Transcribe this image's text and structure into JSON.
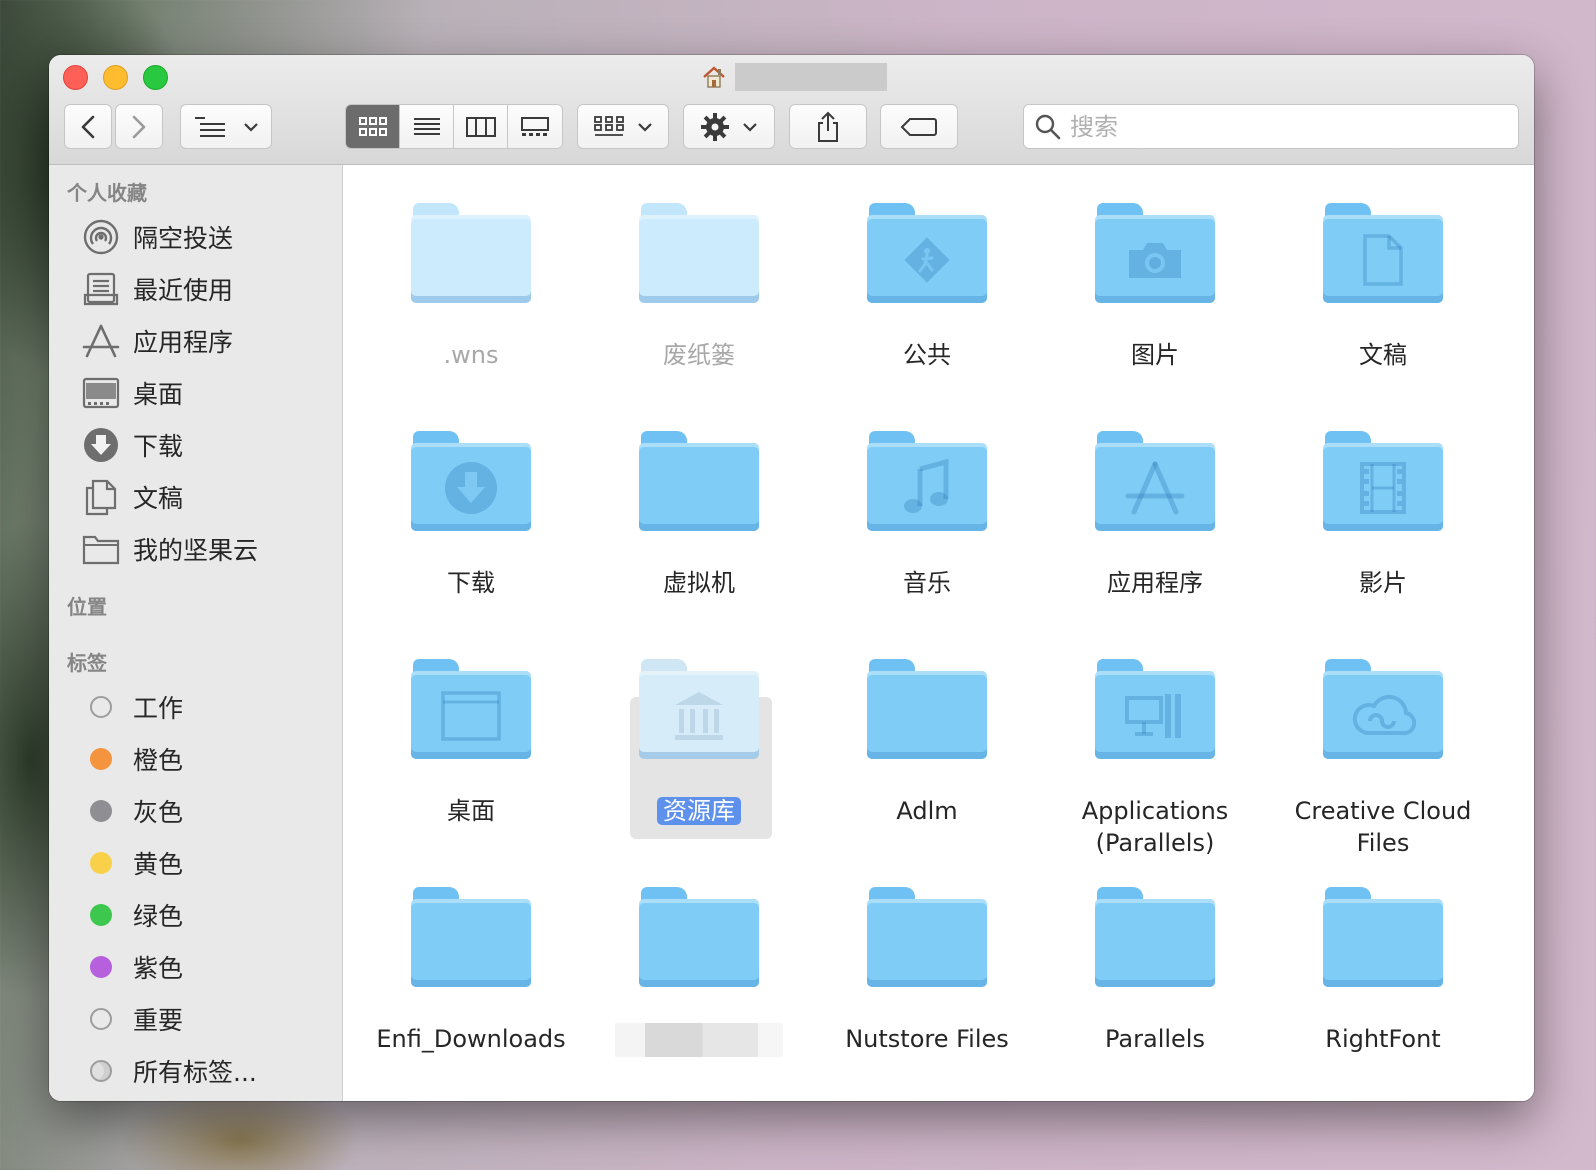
{
  "window": {
    "title": ""
  },
  "search": {
    "placeholder": "搜索",
    "value": ""
  },
  "sidebar": {
    "favorites_title": "个人收藏",
    "favorites": [
      {
        "label": "隔空投送",
        "icon": "airdrop-icon"
      },
      {
        "label": "最近使用",
        "icon": "recents-icon"
      },
      {
        "label": "应用程序",
        "icon": "applications-icon"
      },
      {
        "label": "桌面",
        "icon": "desktop-icon"
      },
      {
        "label": "下载",
        "icon": "downloads-icon"
      },
      {
        "label": "文稿",
        "icon": "documents-icon"
      },
      {
        "label": "我的坚果云",
        "icon": "folder-icon"
      }
    ],
    "locations_title": "位置",
    "tags_title": "标签",
    "tags": [
      {
        "label": "工作",
        "color": "#e4e4e4"
      },
      {
        "label": "橙色",
        "color": "#f5943e"
      },
      {
        "label": "灰色",
        "color": "#8e8e93"
      },
      {
        "label": "黄色",
        "color": "#f9d04a"
      },
      {
        "label": "绿色",
        "color": "#3ec74f"
      },
      {
        "label": "紫色",
        "color": "#b660dd"
      },
      {
        "label": "重要",
        "color": "#e4e4e4"
      },
      {
        "label": "所有标签...",
        "color": "#d0d0d0"
      }
    ]
  },
  "files": [
    {
      "name": ".wns",
      "glyph": "none",
      "faint": true
    },
    {
      "name": "废纸篓",
      "glyph": "none",
      "faint": true
    },
    {
      "name": "公共",
      "glyph": "public-icon"
    },
    {
      "name": "图片",
      "glyph": "camera-icon"
    },
    {
      "name": "文稿",
      "glyph": "document-icon"
    },
    {
      "name": "下载",
      "glyph": "download-icon"
    },
    {
      "name": "虚拟机",
      "glyph": "none"
    },
    {
      "name": "音乐",
      "glyph": "music-icon"
    },
    {
      "name": "应用程序",
      "glyph": "appstore-icon"
    },
    {
      "name": "影片",
      "glyph": "film-icon"
    },
    {
      "name": "桌面",
      "glyph": "desktop-window-icon"
    },
    {
      "name": "资源库",
      "glyph": "library-icon",
      "faint_icon": true,
      "selected": true
    },
    {
      "name": "Adlm",
      "glyph": "none"
    },
    {
      "name": "Applications\n(Parallels)",
      "glyph": "parallels-apps-icon"
    },
    {
      "name": "Creative Cloud\nFiles",
      "glyph": "creative-cloud-icon"
    },
    {
      "name": "Enfi_Downloads",
      "glyph": "none"
    },
    {
      "name": "",
      "glyph": "none",
      "redacted": true
    },
    {
      "name": "Nutstore Files",
      "glyph": "none"
    },
    {
      "name": "Parallels",
      "glyph": "none"
    },
    {
      "name": "RightFont",
      "glyph": "none"
    }
  ]
}
